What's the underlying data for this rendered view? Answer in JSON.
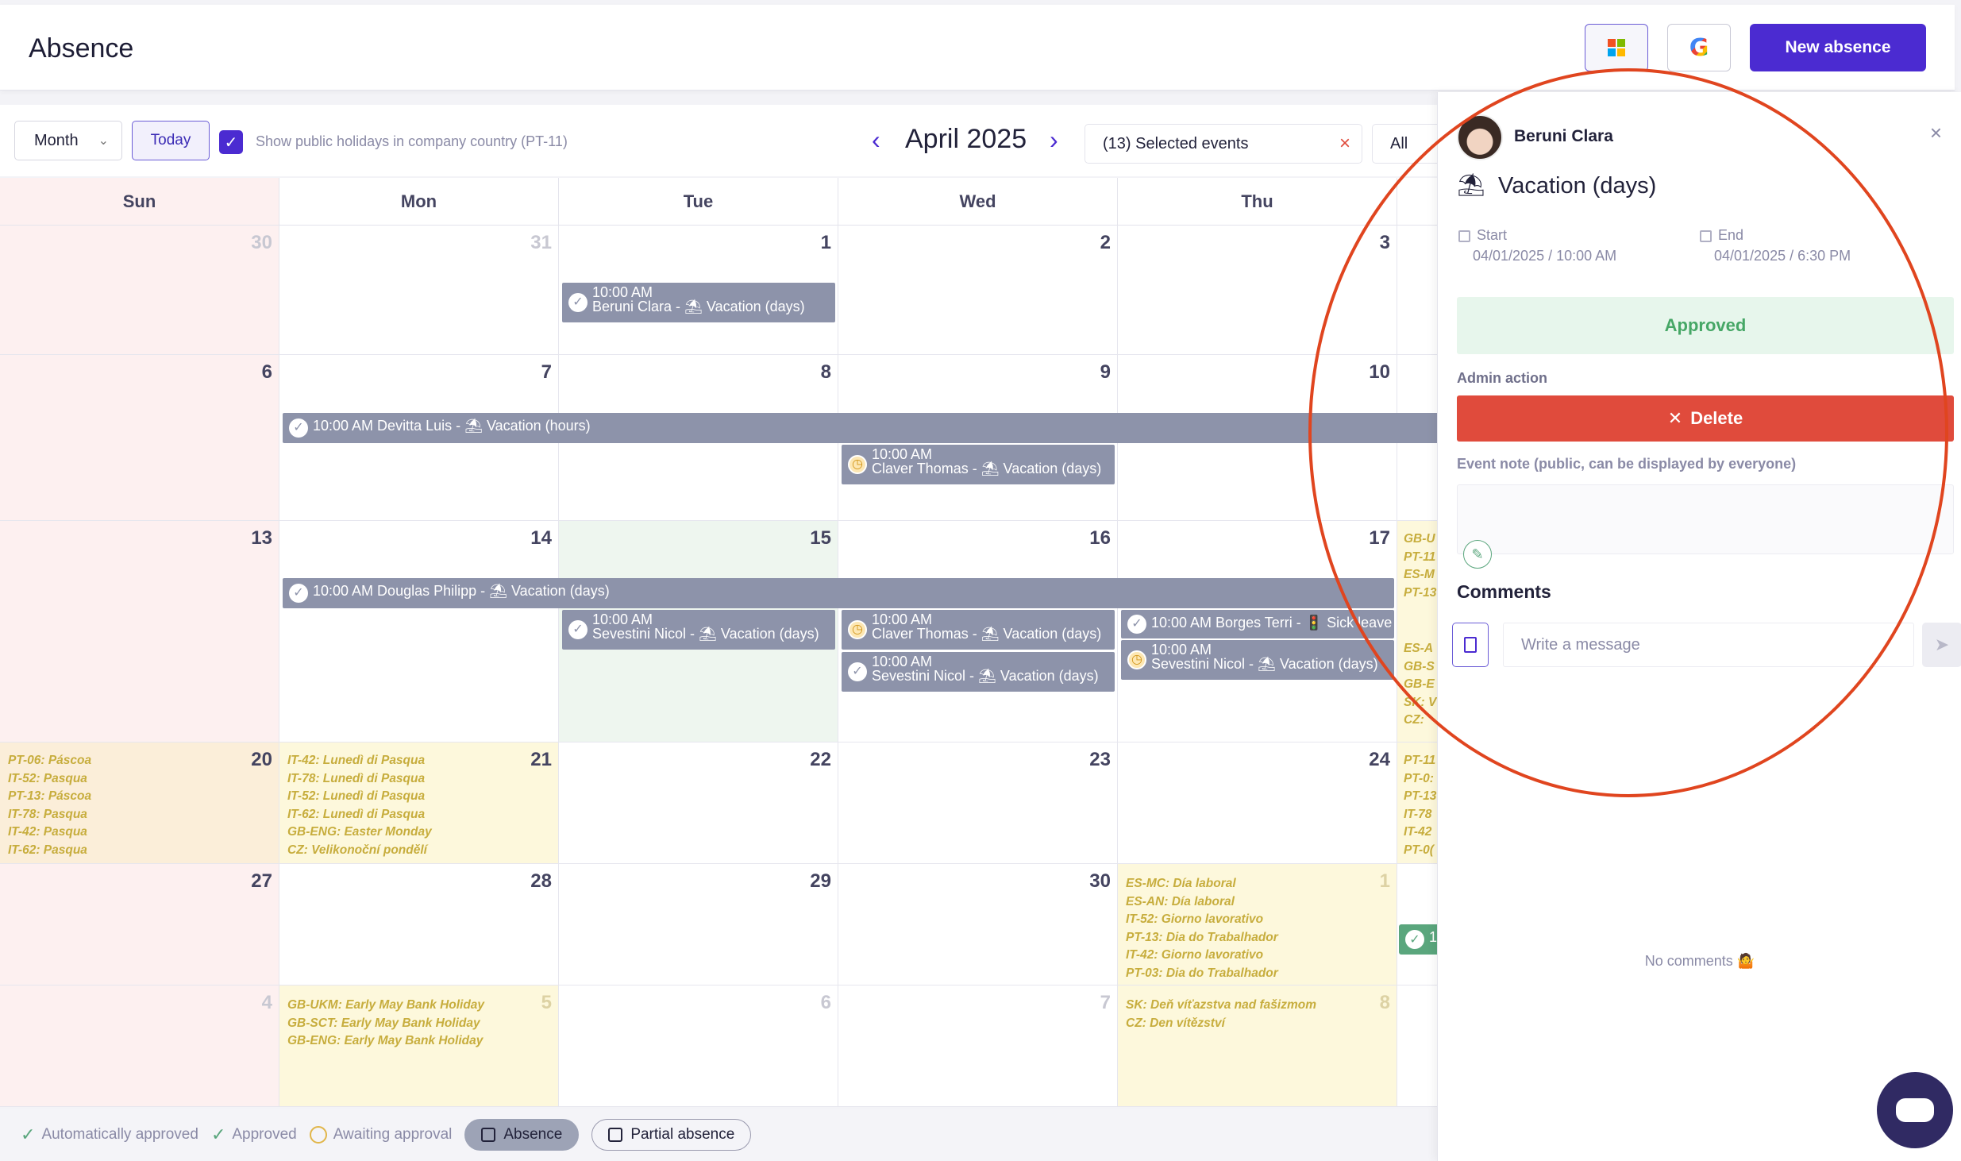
{
  "header": {
    "title": "Absence",
    "new_absence_label": "New absence"
  },
  "toolbar": {
    "view": "Month",
    "today_label": "Today",
    "holidays_label": "Show public holidays in company country (PT-11)",
    "month_title": "April 2025",
    "selected_events": "(13) Selected events",
    "filter": "All"
  },
  "calendar": {
    "days_of_week": [
      "Sun",
      "Mon",
      "Tue",
      "Wed",
      "Thu"
    ],
    "weeks": [
      [
        "30",
        "31",
        "1",
        "2",
        "3"
      ],
      [
        "6",
        "7",
        "8",
        "9",
        "10"
      ],
      [
        "13",
        "14",
        "15",
        "16",
        "17"
      ],
      [
        "20",
        "21",
        "22",
        "23",
        "24"
      ],
      [
        "27",
        "28",
        "29",
        "30",
        "1"
      ],
      [
        "4",
        "5",
        "6",
        "7",
        "8"
      ]
    ],
    "holidays": {
      "w3d0": [
        "PT-06: Páscoa",
        "IT-52: Pasqua",
        "PT-13: Páscoa",
        "IT-78: Pasqua",
        "IT-42: Pasqua",
        "IT-62: Pasqua"
      ],
      "w3d1": [
        "IT-42: Lunedì di Pasqua",
        "IT-78: Lunedì di Pasqua",
        "IT-52: Lunedì di Pasqua",
        "IT-62: Lunedì di Pasqua",
        "GB-ENG: Easter Monday",
        "CZ: Velikonoční pondělí"
      ],
      "w4d4": [
        "ES-MC: Día laboral",
        "ES-AN: Día laboral",
        "IT-52: Giorno lavorativo",
        "PT-13: Dia do Trabalhador",
        "IT-42: Giorno lavorativo",
        "PT-03: Dia do Trabalhador"
      ],
      "w5d1": [
        "GB-UKM: Early May Bank Holiday",
        "GB-SCT: Early May Bank Holiday",
        "GB-ENG: Early May Bank Holiday"
      ],
      "w5d4": [
        "SK: Deň víťazstva nad fašizmom",
        "CZ: Den vítězství"
      ],
      "col5_w2": [
        "GB-U",
        "PT-11",
        "ES-M",
        "PT-13"
      ],
      "col5_w2b": [
        "ES-A",
        "GB-S",
        "GB-E",
        "SK: V",
        "CZ: "
      ],
      "col5_w3": [
        "PT-11",
        "PT-0:",
        "PT-13",
        "IT-78",
        "IT-42",
        "PT-0("
      ]
    },
    "events": {
      "e1": {
        "time": "10:00 AM",
        "text": "Beruni Clara - ⛱ Vacation (days)"
      },
      "e2": {
        "text": "10:00 AM Devitta Luis - ⛱ Vacation (hours)"
      },
      "e3": {
        "time": "10:00 AM",
        "text": "Claver Thomas - ⛱ Vacation (days)"
      },
      "e4": {
        "text": "10:00 AM Douglas Philipp - ⛱ Vacation (days)"
      },
      "e5": {
        "time": "10:00 AM",
        "text": "Sevestini Nicol - ⛱ Vacation (days)"
      },
      "e6": {
        "time": "10:00 AM",
        "text": "Claver Thomas - ⛱ Vacation (days)"
      },
      "e7": {
        "time": "10:00 AM",
        "text": "Sevestini Nicol - ⛱ Vacation (days)"
      },
      "e8": {
        "text": "10:00 AM Borges Terri - 🚦 Sick leave"
      },
      "e9": {
        "time": "10:00 AM",
        "text": "Sevestini Nicol - ⛱ Vacation (days)"
      },
      "e10": {
        "text": "1"
      }
    }
  },
  "legend": {
    "auto_approved": "Automatically approved",
    "approved": "Approved",
    "awaiting": "Awaiting approval",
    "absence": "Absence",
    "partial": "Partial absence"
  },
  "panel": {
    "employee_name": "Beruni Clara",
    "absence_type": "Vacation (days)",
    "start_label": "Start",
    "start_value": "04/01/2025 / 10:00 AM",
    "end_label": "End",
    "end_value": "04/01/2025 / 6:30 PM",
    "status": "Approved",
    "admin_action_label": "Admin action",
    "delete_label": "Delete",
    "event_note_label": "Event note (public, can be displayed by everyone)",
    "comments_title": "Comments",
    "message_placeholder": "Write a message",
    "no_comments": "No comments 🤷"
  },
  "colors": {
    "brand": "#4b2bd1",
    "event": "#8d93aa",
    "approved": "#46a766",
    "delete": "#e04b3c",
    "holiday_text": "#c7ad3d",
    "highlight": "#e0451f"
  }
}
